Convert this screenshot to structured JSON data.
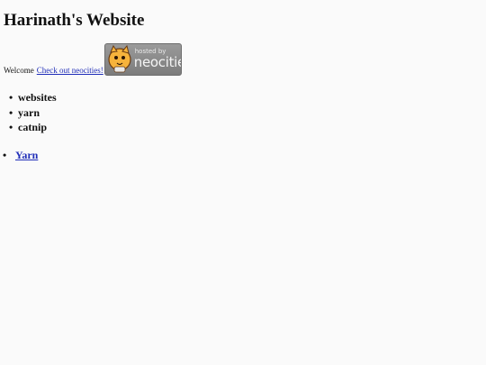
{
  "page": {
    "title": "Harinath's Website"
  },
  "welcome": {
    "text": "Welcome",
    "link_text": "Check out neocities!"
  },
  "badge": {
    "hosted_by": "hosted by",
    "brand": "neocities"
  },
  "list": {
    "items": [
      "websites",
      "yarn",
      "catnip"
    ]
  },
  "link_list": {
    "bullet": "•",
    "items": [
      "Yarn"
    ]
  },
  "colors": {
    "background": "#fafafa",
    "link": "#1f2db8",
    "badge": "#8a8a8a"
  }
}
